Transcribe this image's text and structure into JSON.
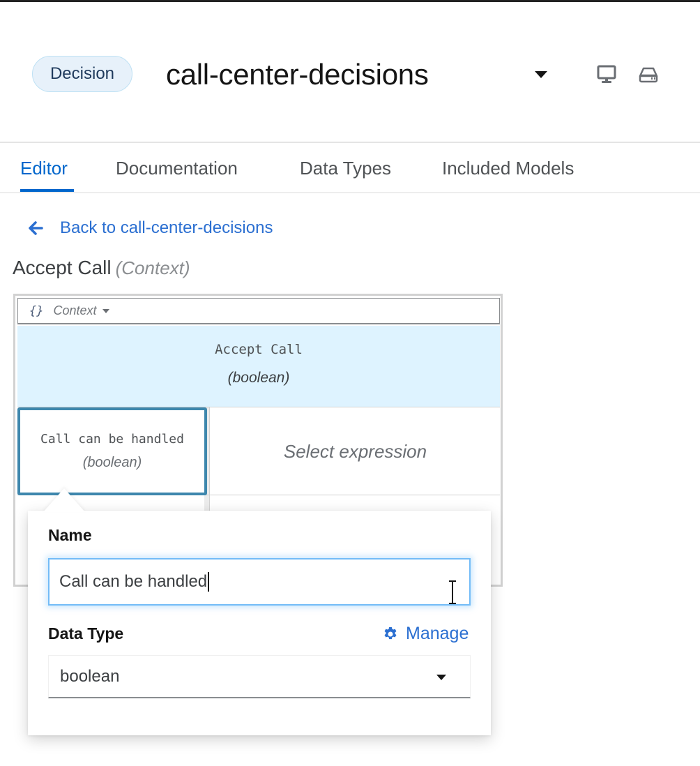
{
  "header": {
    "badge": "Decision",
    "title": "call-center-decisions",
    "icons": [
      "caret-down-icon",
      "desktop-icon",
      "hard-drive-icon"
    ]
  },
  "tabs": [
    {
      "label": "Editor",
      "active": true
    },
    {
      "label": "Documentation",
      "active": false
    },
    {
      "label": "Data Types",
      "active": false
    },
    {
      "label": "Included Models",
      "active": false
    }
  ],
  "back_link": {
    "label": "Back to call-center-decisions",
    "icon": "arrow-left-icon"
  },
  "context_title": {
    "name": "Accept Call",
    "kind": "(Context)"
  },
  "grid": {
    "expression_type": {
      "icon": "braces-icon",
      "label": "Context"
    },
    "result": {
      "name": "Accept Call",
      "type": "(boolean)"
    },
    "entries": [
      {
        "name": "Call can be handled",
        "type": "(boolean)",
        "expression": "Select expression"
      }
    ]
  },
  "popover": {
    "name_label": "Name",
    "name_value": "Call can be handled",
    "data_type_label": "Data Type",
    "manage_label": "Manage",
    "data_type_value": "boolean"
  },
  "colors": {
    "accent": "#0066cc",
    "link": "#2b6fd1",
    "header_cell_bg": "#def3ff",
    "selected_cell_border": "#3e87ad",
    "input_focus": "#73bcf7"
  }
}
